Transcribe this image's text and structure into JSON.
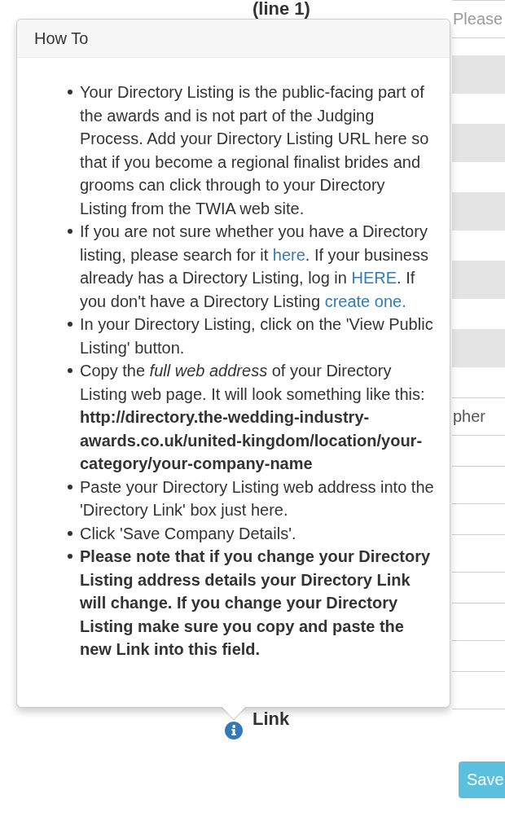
{
  "form": {
    "fields": [
      {
        "label": "(line 1)",
        "placeholder": "Please",
        "disabled": false
      },
      {
        "disabled": true
      },
      {
        "disabled": true
      },
      {
        "disabled": true
      },
      {
        "disabled": true
      },
      {
        "disabled": true
      },
      {
        "value": "pher",
        "disabled": false
      },
      {
        "disabled": false
      },
      {
        "disabled": false
      },
      {
        "disabled": false
      },
      {
        "disabled": false
      }
    ],
    "link_label": "Link",
    "save_button": "Save"
  },
  "popover": {
    "title": "How To",
    "items": [
      {
        "bold": false,
        "parts": [
          {
            "kind": "text",
            "text": "Your Directory Listing is the public-facing part of the awards and is not part of the Judging Process. Add your Directory Listing URL here so that if you become a regional finalist brides and grooms can click through to your Directory Listing from the TWIA web site."
          }
        ]
      },
      {
        "bold": false,
        "parts": [
          {
            "kind": "text",
            "text": "If you are not sure whether you have a Directory listing, please search for it "
          },
          {
            "kind": "link",
            "text": "here"
          },
          {
            "kind": "text",
            "text": ". If your business already has a Directory Listing, log in "
          },
          {
            "kind": "link",
            "text": "HERE"
          },
          {
            "kind": "text",
            "text": ". If you don't have a Directory Listing "
          },
          {
            "kind": "link",
            "text": "create one."
          }
        ]
      },
      {
        "bold": false,
        "parts": [
          {
            "kind": "text",
            "text": "In your Directory Listing, click on the 'View Public Listing' button."
          }
        ]
      },
      {
        "bold": false,
        "parts": [
          {
            "kind": "text",
            "text": "Copy the *full web address* of your Directory Listing web page. It will look something like this: **http://directory.the-wedding-industry-awards.co.uk/united-kingdom/location/your-category/your-company-name**"
          }
        ]
      },
      {
        "bold": false,
        "parts": [
          {
            "kind": "text",
            "text": "Paste your Directory Listing web address into the 'Directory Link' box just here."
          }
        ]
      },
      {
        "bold": false,
        "parts": [
          {
            "kind": "text",
            "text": "Click 'Save Company Details'."
          }
        ]
      },
      {
        "bold": true,
        "parts": [
          {
            "kind": "text",
            "text": "Please note that if you change your Directory Listing address details your Directory Link will change. If you change your Directory Listing make sure you copy and paste the new Link into this field."
          }
        ]
      }
    ]
  }
}
